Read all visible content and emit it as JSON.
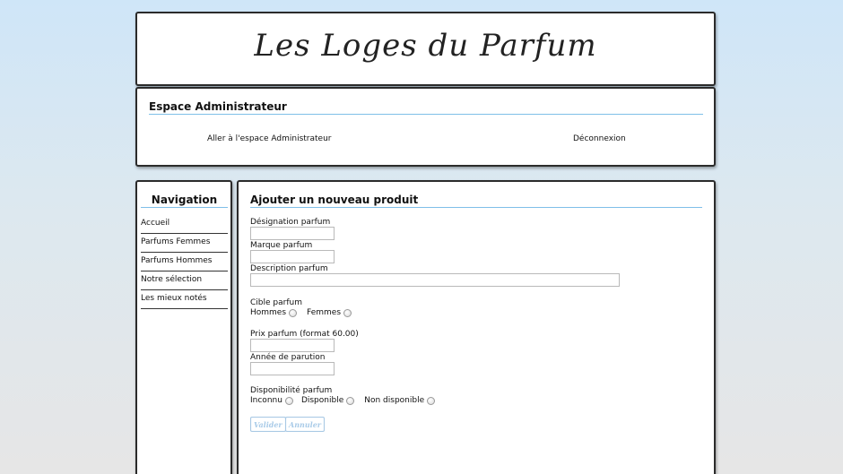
{
  "header": {
    "site_title": "Les Loges du Parfum"
  },
  "admin": {
    "heading": "Espace Administrateur",
    "admin_link": "Aller à l'espace Administrateur",
    "logout_link": "Déconnexion"
  },
  "nav": {
    "heading": "Navigation",
    "items": [
      {
        "label": "Accueil"
      },
      {
        "label": "Parfums Femmes"
      },
      {
        "label": "Parfums Hommes"
      },
      {
        "label": "Notre sélection"
      },
      {
        "label": "Les mieux notés"
      }
    ]
  },
  "form": {
    "heading": "Ajouter un nouveau produit",
    "designation_label": "Désignation parfum",
    "designation_value": "",
    "marque_label": "Marque parfum",
    "marque_value": "",
    "description_label": "Description parfum",
    "description_value": "",
    "cible_label": "Cible parfum",
    "cible_options": [
      "Hommes",
      "Femmes"
    ],
    "prix_label": "Prix parfum (format 60.00)",
    "prix_value": "",
    "annee_label": "Année de parution",
    "annee_value": "",
    "dispo_label": "Disponibilité parfum",
    "dispo_options": [
      "Inconnu",
      "Disponible",
      "Non disponible"
    ],
    "submit_label": "Valider",
    "cancel_label": "Annuler"
  },
  "colors": {
    "heading_underline": "#7fbfe8",
    "box_border": "#2b2b2b",
    "button_text": "#a9cbe8"
  }
}
